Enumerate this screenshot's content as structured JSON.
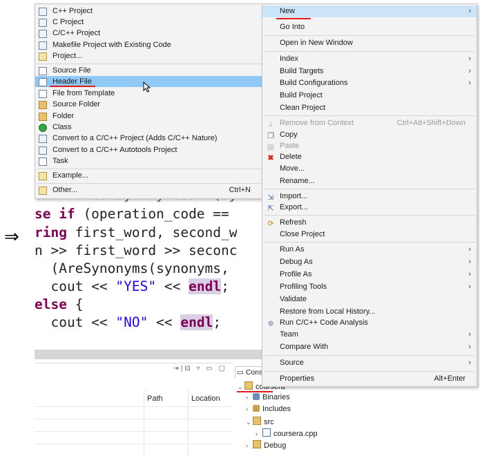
{
  "arrow_symbol": "⇒",
  "new_submenu": {
    "items": [
      {
        "label": "C++ Project",
        "icon": "cpp-project-icon"
      },
      {
        "label": "C Project",
        "icon": "c-project-icon"
      },
      {
        "label": "C/C++ Project",
        "icon": "cc-project-icon"
      },
      {
        "label": "Makefile Project with Existing Code",
        "icon": "makefile-project-icon"
      },
      {
        "label": "Project...",
        "icon": "project-icon"
      },
      {
        "label": "Source File",
        "icon": "source-file-icon"
      },
      {
        "label": "Header File",
        "icon": "header-file-icon",
        "selected": true
      },
      {
        "label": "File from Template",
        "icon": "file-template-icon"
      },
      {
        "label": "Source Folder",
        "icon": "source-folder-icon"
      },
      {
        "label": "Folder",
        "icon": "folder-icon"
      },
      {
        "label": "Class",
        "icon": "class-icon"
      },
      {
        "label": "Convert to a C/C++ Project (Adds C/C++ Nature)",
        "icon": "convert-icon"
      },
      {
        "label": "Convert to a C/C++ Autotools Project",
        "icon": "convert-autotools-icon"
      },
      {
        "label": "Task",
        "icon": "task-icon"
      },
      {
        "label": "Example...",
        "icon": "example-icon"
      },
      {
        "label": "Other...",
        "icon": "other-icon",
        "accel": "Ctrl+N"
      }
    ]
  },
  "context_menu": {
    "items": [
      {
        "label": "New",
        "submenu": true,
        "selected": true
      },
      {
        "label": "Go Into"
      },
      {
        "label": "Open in New Window"
      },
      {
        "label": "Index",
        "submenu": true
      },
      {
        "label": "Build Targets",
        "submenu": true
      },
      {
        "label": "Build Configurations",
        "submenu": true
      },
      {
        "label": "Build Project"
      },
      {
        "label": "Clean Project"
      },
      {
        "label": "Remove from Context",
        "accel": "Ctrl+Alt+Shift+Down",
        "disabled": true
      },
      {
        "label": "Copy",
        "icon": "copy-icon"
      },
      {
        "label": "Paste",
        "icon": "paste-icon",
        "disabled": true
      },
      {
        "label": "Delete",
        "icon": "delete-icon"
      },
      {
        "label": "Move..."
      },
      {
        "label": "Rename..."
      },
      {
        "label": "Import...",
        "icon": "import-icon"
      },
      {
        "label": "Export...",
        "icon": "export-icon"
      },
      {
        "label": "Refresh",
        "icon": "refresh-icon"
      },
      {
        "label": "Close Project"
      },
      {
        "label": "Run As",
        "submenu": true
      },
      {
        "label": "Debug As",
        "submenu": true
      },
      {
        "label": "Profile As",
        "submenu": true
      },
      {
        "label": "Profiling Tools",
        "submenu": true
      },
      {
        "label": "Validate"
      },
      {
        "label": "Restore from Local History..."
      },
      {
        "label": "Run C/C++ Code Analysis",
        "icon": "code-analysis-icon"
      },
      {
        "label": "Team",
        "submenu": true
      },
      {
        "label": "Compare With",
        "submenu": true
      },
      {
        "label": "Source",
        "submenu": true
      },
      {
        "label": "Properties",
        "accel": "Alt+Enter"
      }
    ]
  },
  "code": {
    "line0": "out << GetSynonymCount(syn",
    "line1_kw": "se if",
    "line1_rest": " (operation_code ==",
    "line2_kw": "ring",
    "line2_rest": " first_word, second_w",
    "line3": "n >> first_word >> seconc",
    "line4": "  (AreSynonyms(synonyms, ",
    "cout": "cout",
    "op": " << ",
    "yes": "\"YES\"",
    "no": "\"NO\"",
    "endl": "endl",
    "semi": ";",
    "else_kw": "else",
    "brace": " {"
  },
  "bottom_panel": {
    "col_path": "Path",
    "col_location": "Location"
  },
  "explorer": {
    "console_tab": "Cons",
    "project": "coursera",
    "items": [
      {
        "label": "Binaries"
      },
      {
        "label": "Includes"
      },
      {
        "label": "src"
      },
      {
        "label": "coursera.cpp"
      },
      {
        "label": "Debug"
      }
    ]
  },
  "colors": {
    "keyword": "#7f0055",
    "string": "#2a00ff",
    "selection": "#90c8f6",
    "annotation_underline": "#e01a1a"
  }
}
